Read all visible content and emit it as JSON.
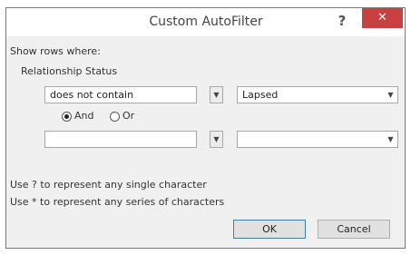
{
  "window": {
    "title": "Custom AutoFilter",
    "help_glyph": "?",
    "close_glyph": "✕"
  },
  "form": {
    "show_rows_label": "Show rows where:",
    "field_label": "Relationship Status",
    "criteria1": {
      "operator": "does not contain",
      "value": "Lapsed"
    },
    "logic": {
      "and_label": "And",
      "or_label": "Or",
      "selected": "And"
    },
    "criteria2": {
      "operator": "",
      "value": ""
    },
    "hint_single": "Use ? to represent any single character",
    "hint_series": "Use * to represent any series of characters"
  },
  "buttons": {
    "ok_label": "OK",
    "cancel_label": "Cancel"
  },
  "icons": {
    "dropdown": "chevron-down-icon",
    "close": "close-icon",
    "help": "help-icon"
  },
  "colors": {
    "close_button": "#c84040",
    "ok_border": "#3c7fb1"
  }
}
